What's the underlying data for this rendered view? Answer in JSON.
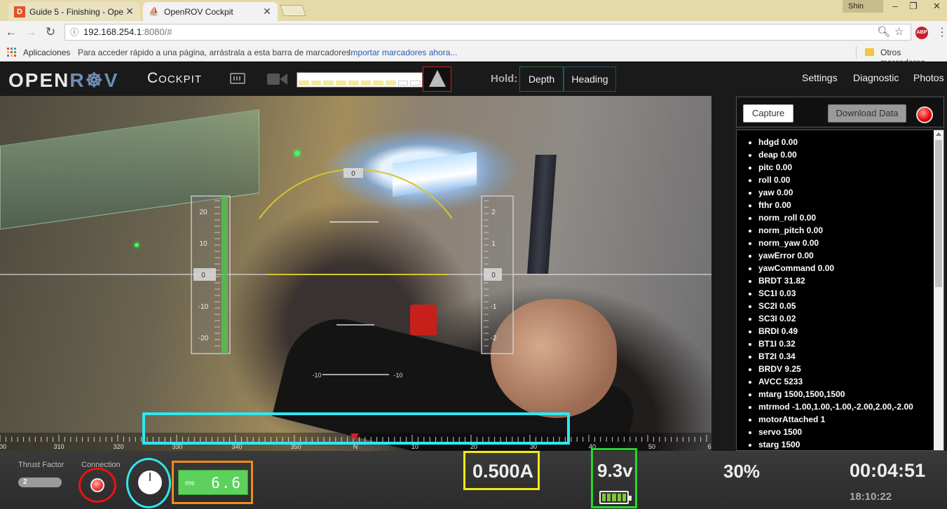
{
  "browser": {
    "tabs": [
      {
        "favicon": "D",
        "title": "Guide 5 - Finishing - Ope"
      },
      {
        "favicon": "openrov-icon",
        "title": "OpenROV Cockpit"
      }
    ],
    "profile_name": "Shin",
    "url_host": "192.168.254.1",
    "url_rest": ":8080/#",
    "bookmarks": {
      "apps_label": "Aplicaciones",
      "hint": "Para acceder rápido a una página, arrástrala a esta barra de marcadores.",
      "import_link": "Importar marcadores ahora...",
      "other_folder": "Otros marcadores"
    }
  },
  "header": {
    "logo_left": "OPEN",
    "logo_r": "R",
    "logo_ov": "V",
    "title": "Cockpit",
    "hold_label": "Hold:",
    "hold_depth": "Depth",
    "hold_heading": "Heading",
    "menu": [
      "Settings",
      "Diagnostic",
      "Photos"
    ],
    "light_level": 0.8
  },
  "hud": {
    "pitch_labels": [
      "20",
      "10",
      "0",
      "-10",
      "-20"
    ],
    "depth_labels": [
      "2",
      "1",
      "0",
      "-1",
      "-2"
    ],
    "roll_top_label": "0",
    "ladder_labels": [
      "-10",
      "-10"
    ]
  },
  "compass": {
    "heading_labels": [
      "00",
      "310",
      "320",
      "330",
      "340",
      "350",
      "N",
      "10",
      "20",
      "30",
      "40",
      "50",
      "6"
    ]
  },
  "side": {
    "capture_label": "Capture",
    "download_label": "Download Data",
    "telemetry": [
      "hdgd 0.00",
      "deap 0.00",
      "pitc 0.00",
      "roll 0.00",
      "yaw 0.00",
      "fthr 0.00",
      "norm_roll 0.00",
      "norm_pitch 0.00",
      "norm_yaw 0.00",
      "yawError 0.00",
      "yawCommand 0.00",
      "BRDT 31.82",
      "SC1I 0.03",
      "SC2I 0.05",
      "SC3I 0.02",
      "BRDI 0.49",
      "BT1I 0.32",
      "BT2I 0.34",
      "BRDV 9.25",
      "AVCC 5233",
      "mtarg 1500,1500,1500",
      "mtrmod -1.00,1.00,-1.00,-2.00,2.00,-2.00",
      "motorAttached 1",
      "servo 1500",
      "starg 1500"
    ]
  },
  "bottom": {
    "thrust_label": "Thrust Factor",
    "thrust_value": "2",
    "connection_label": "Connection",
    "latency_unit": "ms",
    "latency_value": "6.6",
    "current": "0.500A",
    "voltage": "9.3v",
    "battery_percent": "30%",
    "timer": "00:04:51",
    "clock": "18:10:22"
  },
  "colors": {
    "highlight_cyan": "#2ee8f0",
    "highlight_red": "#e11111",
    "highlight_orange": "#f08a1a",
    "highlight_yellow": "#f2ea14",
    "highlight_green": "#28d62a",
    "hud_yellow": "#d8c430"
  }
}
